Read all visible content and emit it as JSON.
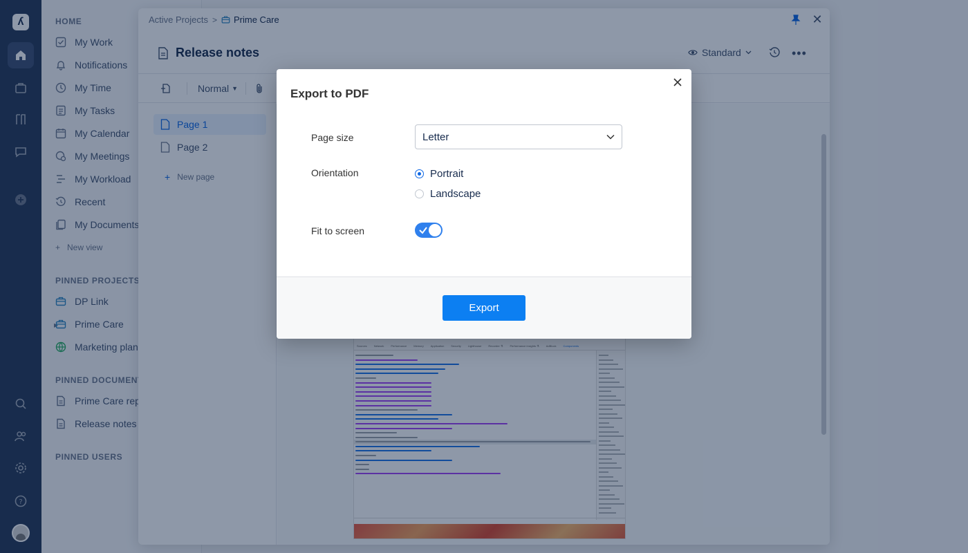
{
  "rail": {
    "logo": "ʎ",
    "icons": [
      "logo-icon",
      "home-icon",
      "briefcase-icon",
      "portfolio-icon",
      "chat-icon",
      "add-icon",
      "search-icon",
      "users-icon",
      "gear-icon",
      "help-icon",
      "avatar"
    ]
  },
  "sidebar": {
    "home_section": "HOME",
    "home_items": [
      {
        "label": "My Work",
        "icon": "checkbox-icon"
      },
      {
        "label": "Notifications",
        "icon": "bell-icon"
      },
      {
        "label": "My Time",
        "icon": "clock-icon"
      },
      {
        "label": "My Tasks",
        "icon": "tasks-icon"
      },
      {
        "label": "My Calendar",
        "icon": "calendar-icon"
      },
      {
        "label": "My Meetings",
        "icon": "meetings-icon"
      },
      {
        "label": "My Workload",
        "icon": "workload-icon"
      },
      {
        "label": "Recent",
        "icon": "history-icon"
      },
      {
        "label": "My Documents",
        "icon": "documents-icon"
      }
    ],
    "new_view": "New view",
    "pinned_projects_section": "PINNED PROJECTS",
    "pinned_projects": [
      {
        "label": "DP Link",
        "icon": "briefcase-icon"
      },
      {
        "label": "Prime Care",
        "icon": "briefcase-icon"
      },
      {
        "label": "Marketing plan",
        "icon": "globe-icon"
      }
    ],
    "pinned_documents_section": "PINNED DOCUMENTS",
    "pinned_documents": [
      {
        "label": "Prime Care report",
        "icon": "document-icon"
      },
      {
        "label": "Release notes",
        "icon": "document-icon"
      }
    ],
    "pinned_users_section": "PINNED USERS"
  },
  "panel": {
    "breadcrumb": {
      "parent": "Active Projects",
      "separator": ">",
      "current": "Prime Care"
    },
    "doc_title": "Release notes",
    "view_label": "Standard",
    "toolbar": {
      "style": "Normal"
    },
    "pages": [
      {
        "label": "Page 1",
        "active": true
      },
      {
        "label": "Page 2",
        "active": false
      }
    ],
    "new_page": "New page"
  },
  "embedded_screenshot": {
    "tabs": [
      "Sources",
      "Network",
      "Performance",
      "Memory",
      "Application",
      "Security",
      "Lighthouse",
      "Recorder ⚗",
      "Performance insights ⚗",
      "AdBlock",
      "Components"
    ]
  },
  "modal": {
    "title": "Export to PDF",
    "page_size_label": "Page size",
    "page_size_value": "Letter",
    "orientation_label": "Orientation",
    "orientation_options": [
      {
        "label": "Portrait",
        "selected": true
      },
      {
        "label": "Landscape",
        "selected": false
      }
    ],
    "fit_label": "Fit to screen",
    "fit_on": true,
    "export_label": "Export"
  },
  "colors": {
    "accent": "#0c7ff2",
    "rail": "#253858",
    "overlay": "rgba(9,30,66,0.46)"
  }
}
